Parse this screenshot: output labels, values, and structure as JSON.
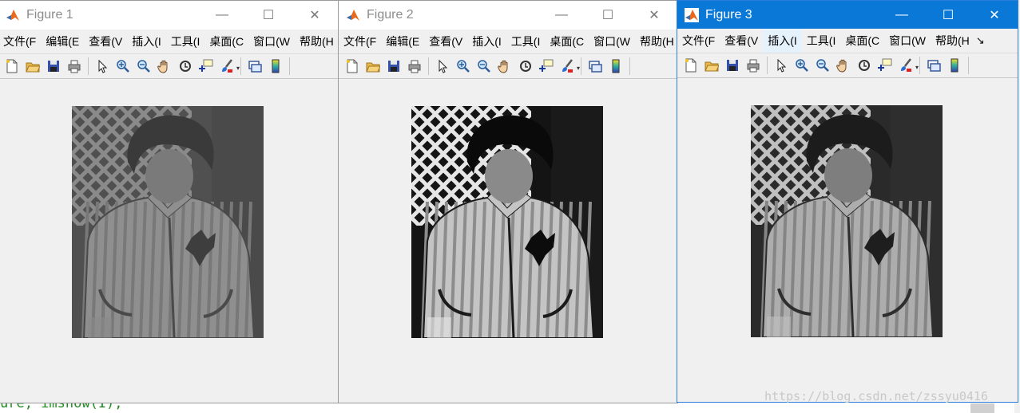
{
  "background_editor": {
    "code_fragment": "ure, imshow(I);"
  },
  "watermark": "https://blog.csdn.net/zssyu0416",
  "menu_labels": [
    "文件(F",
    "编辑(E",
    "查看(V",
    "插入(I",
    "工具(I",
    "桌面(C",
    "窗口(W",
    "帮助(H"
  ],
  "menu_more_symbol": "↘",
  "window_buttons": {
    "minimize": "—",
    "maximize": "☐",
    "close": "✕"
  },
  "toolbar_icons": [
    "new-figure-icon",
    "open-file-icon",
    "save-icon",
    "print-icon",
    "pointer-icon",
    "zoom-in-icon",
    "zoom-out-icon",
    "pan-hand-icon",
    "rotate-3d-icon",
    "data-cursor-icon",
    "brush-icon",
    "link-plot-icon",
    "colorbar-icon"
  ],
  "windows": [
    {
      "title": "Figure 1",
      "active": false,
      "contrast": "low"
    },
    {
      "title": "Figure 2",
      "active": false,
      "contrast": "high"
    },
    {
      "title": "Figure 3",
      "active": true,
      "contrast": "medium"
    }
  ],
  "colors": {
    "active_titlebar": "#0a78d7",
    "inactive_titlebar": "#ffffff",
    "window_body": "#f0f0f0",
    "code_green": "#228b22"
  }
}
